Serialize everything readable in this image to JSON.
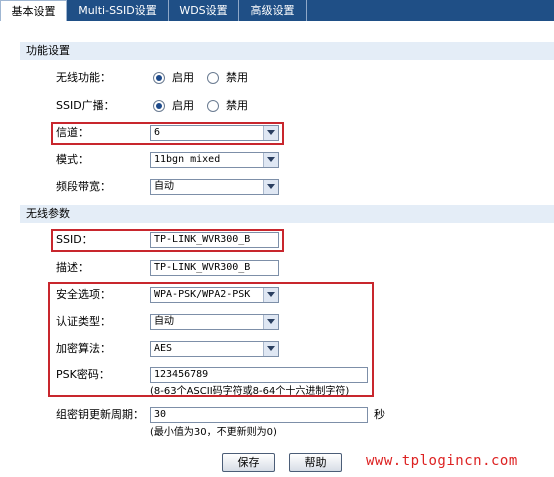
{
  "tabs": [
    {
      "label": "基本设置"
    },
    {
      "label": "Multi-SSID设置"
    },
    {
      "label": "WDS设置"
    },
    {
      "label": "高级设置"
    }
  ],
  "function_section": {
    "title": "功能设置",
    "wireless": {
      "label": "无线功能：",
      "options": [
        "启用",
        "禁用"
      ],
      "selected": "启用"
    },
    "ssid_broadcast": {
      "label": "SSID广播：",
      "options": [
        "启用",
        "禁用"
      ],
      "selected": "启用"
    },
    "channel": {
      "label": "信道：",
      "value": "6"
    },
    "mode": {
      "label": "模式：",
      "value": "11bgn mixed"
    },
    "bandwidth": {
      "label": "频段带宽：",
      "value": "自动"
    }
  },
  "wireless_section": {
    "title": "无线参数",
    "ssid": {
      "label": "SSID：",
      "value": "TP-LINK_WVR300_B"
    },
    "description": {
      "label": "描述：",
      "value": "TP-LINK_WVR300_B"
    },
    "security": {
      "label": "安全选项：",
      "value": "WPA-PSK/WPA2-PSK"
    },
    "auth_type": {
      "label": "认证类型：",
      "value": "自动"
    },
    "encryption": {
      "label": "加密算法：",
      "value": "AES"
    },
    "psk": {
      "label": "PSK密码：",
      "value": "123456789",
      "hint": "(8-63个ASCII码字符或8-64个十六进制字符)"
    },
    "group_key": {
      "label": "组密钥更新周期：",
      "value": "30",
      "unit": "秒",
      "hint": "(最小值为30，不更新则为0)"
    }
  },
  "buttons": {
    "save": "保存",
    "help": "帮助"
  },
  "watermark": "www.tplogincn.com",
  "colors": {
    "tabbar": "#1f4f86",
    "section": "#e4edf7",
    "highlight": "#c8262d",
    "watermark": "#dd2222"
  }
}
